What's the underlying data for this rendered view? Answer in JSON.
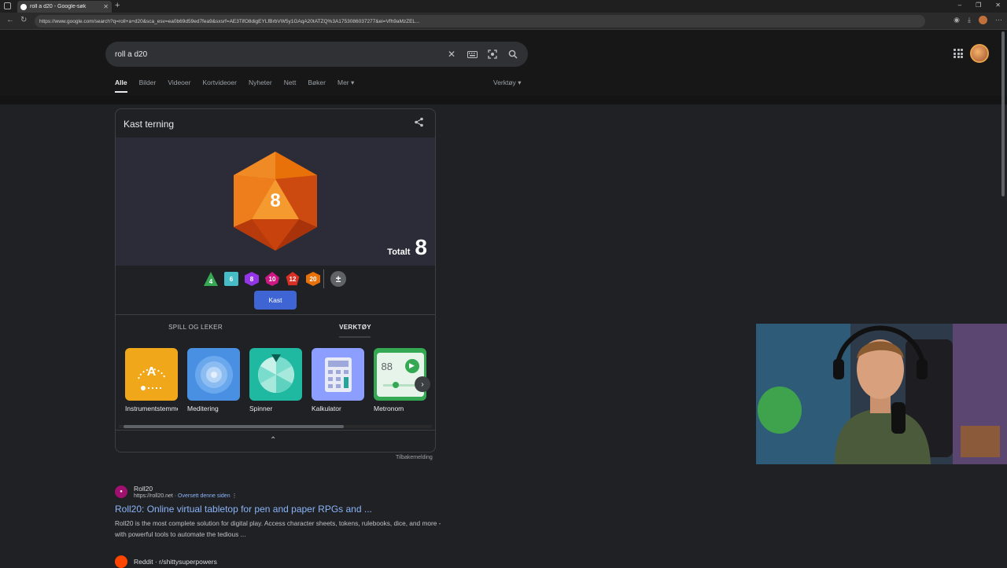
{
  "browser": {
    "tab_title": "roll a d20 - Google-søk",
    "url": "https://www.google.com/search?q=roll+a+d20&sca_esv=ea0b69d59ed7fea9&sxsrf=AE3TifO8digEYLfBrbVW5y1GAqA20tATZQ%3A1753086037277&ei=Vfh9aMzZEL..."
  },
  "search": {
    "query": "roll a d20"
  },
  "nav_tabs": [
    "Alle",
    "Bilder",
    "Videoer",
    "Kortvideoer",
    "Nyheter",
    "Nett",
    "Bøker",
    "Mer"
  ],
  "tools_label": "Verktøy",
  "dice_widget": {
    "title": "Kast terning",
    "die_value": "8",
    "total_label": "Totalt",
    "total_value": "8",
    "dice": [
      "4",
      "6",
      "8",
      "10",
      "12",
      "20"
    ],
    "modifier": "±",
    "roll_label": "Kast",
    "categories": [
      "SPILL OG LEKER",
      "VERKTØY"
    ],
    "tools": [
      {
        "label": "Instrumentstemmer",
        "icon": "tuner-icon"
      },
      {
        "label": "Meditering",
        "icon": "meditation-icon"
      },
      {
        "label": "Spinner",
        "icon": "spinner-icon"
      },
      {
        "label": "Kalkulator",
        "icon": "calculator-icon"
      },
      {
        "label": "Metronom",
        "icon": "metronome-icon"
      }
    ],
    "metronome_value": "88",
    "tuner_letter": "A"
  },
  "feedback_label": "Tilbakemelding",
  "results": [
    {
      "site_name": "Roll20",
      "url": "https://roll20.net",
      "translate": "Oversett denne siden",
      "title": "Roll20: Online virtual tabletop for pen and paper RPGs and ...",
      "snippet": "Roll20 is the most complete solution for digital play. Access character sheets, tokens, rulebooks, dice, and more - with powerful tools to automate the tedious ..."
    },
    {
      "site_name": "Reddit · r/shittysuperpowers"
    }
  ],
  "colors": {
    "accent": "#3f64d4",
    "link": "#8ab4f8",
    "die": "#e8710a"
  }
}
